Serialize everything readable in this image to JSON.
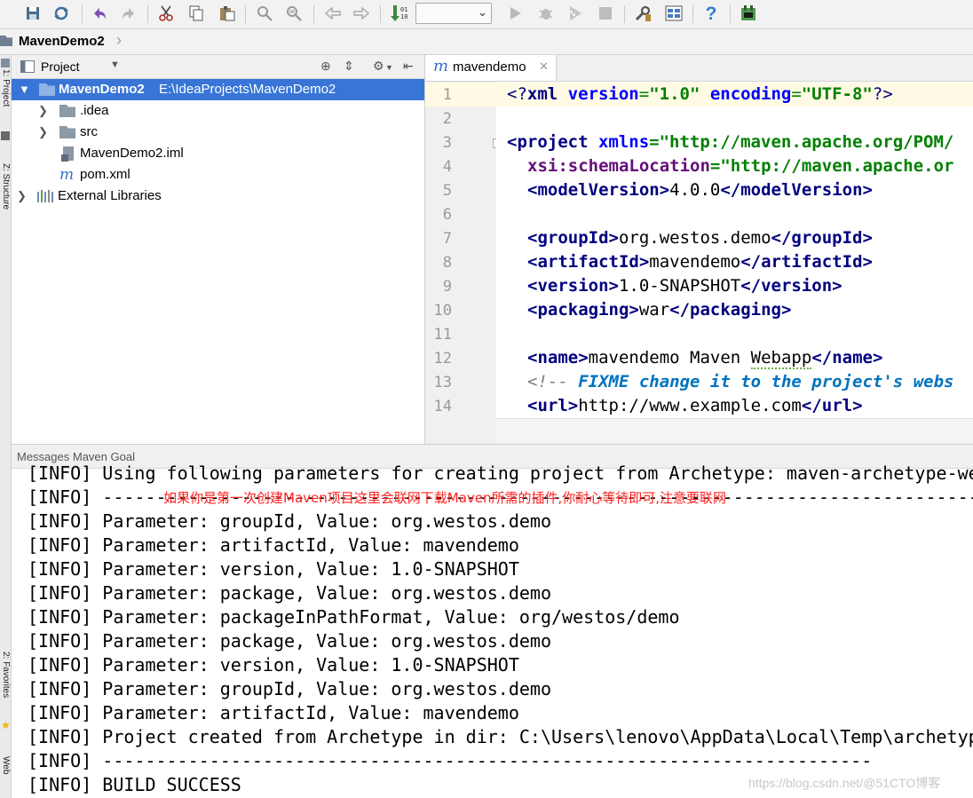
{
  "toolbar": {
    "icons": [
      "save-icon",
      "sync-icon",
      "undo-icon",
      "redo-icon",
      "cut-icon",
      "copy-icon",
      "paste-icon",
      "find-icon",
      "replace-icon",
      "back-icon",
      "forward-icon",
      "make-project-icon",
      "run-config-select",
      "run-icon",
      "debug-icon",
      "coverage-icon",
      "stop-icon",
      "settings-icon",
      "project-structure-icon",
      "help-icon",
      "event-log-icon"
    ],
    "run_config_value": ""
  },
  "navbar": {
    "breadcrumb": "MavenDemo2"
  },
  "left_strip": {
    "tab1": "1: Project",
    "tab2": "Z: Structure",
    "tab3": "2: Favorites",
    "tab4": "Web"
  },
  "project_panel": {
    "title": "Project",
    "tree": [
      {
        "label": "MavenDemo2",
        "path": "E:\\IdeaProjects\\MavenDemo2"
      },
      {
        "label": ".idea"
      },
      {
        "label": "src"
      },
      {
        "label": "MavenDemo2.iml"
      },
      {
        "label": "pom.xml"
      },
      {
        "label": "External Libraries"
      }
    ]
  },
  "editor": {
    "tab_label": "mavendemo",
    "tab_icon_letter": "m",
    "lines": [
      {
        "n": "1"
      },
      {
        "n": "2"
      },
      {
        "n": "3"
      },
      {
        "n": "4"
      },
      {
        "n": "5"
      },
      {
        "n": "6"
      },
      {
        "n": "7"
      },
      {
        "n": "8"
      },
      {
        "n": "9"
      },
      {
        "n": "10"
      },
      {
        "n": "11"
      },
      {
        "n": "12"
      },
      {
        "n": "13"
      },
      {
        "n": "14"
      }
    ],
    "code": {
      "l1_a": "<?",
      "l1_b": "xml",
      "l1_c": " version",
      "l1_d": "=",
      "l1_e": "\"1.0\"",
      "l1_f": " encoding",
      "l1_g": "=",
      "l1_h": "\"UTF-8\"",
      "l1_i": "?>",
      "l3_a": "<project",
      "l3_b": " xmlns",
      "l3_c": "=",
      "l3_d": "\"http://maven.apache.org/POM/",
      "l4_a": "xsi:schemaLocation",
      "l4_b": "=",
      "l4_c": "\"http://maven.apache.or",
      "l5_a": "<modelVersion>",
      "l5_b": "4.0.0",
      "l5_c": "</modelVersion>",
      "l7_a": "<groupId>",
      "l7_b": "org.westos.demo",
      "l7_c": "</groupId>",
      "l8_a": "<artifactId>",
      "l8_b": "mavendemo",
      "l8_c": "</artifactId>",
      "l9_a": "<version>",
      "l9_b": "1.0-SNAPSHOT",
      "l9_c": "</version>",
      "l10_a": "<packaging>",
      "l10_b": "war",
      "l10_c": "</packaging>",
      "l12_a": "<name>",
      "l12_b": "mavendemo Maven ",
      "l12_c": "Webapp",
      "l12_d": "</name>",
      "l13_a": "<!-- ",
      "l13_b": "FIXME change it to the project's webs",
      "l14_a": "<url>",
      "l14_b": "http://www.example.com",
      "l14_c": "</url>"
    }
  },
  "messages": {
    "title": "Messages Maven Goal",
    "log": [
      "[INFO] Using following parameters for creating project from Archetype: maven-archetype-we",
      "[INFO] -----------------------------------------------------------------------------------",
      "[INFO] Parameter: groupId, Value: org.westos.demo",
      "[INFO] Parameter: artifactId, Value: mavendemo",
      "[INFO] Parameter: version, Value: 1.0-SNAPSHOT",
      "[INFO] Parameter: package, Value: org.westos.demo",
      "[INFO] Parameter: packageInPathFormat, Value: org/westos/demo",
      "[INFO] Parameter: package, Value: org.westos.demo",
      "[INFO] Parameter: version, Value: 1.0-SNAPSHOT",
      "[INFO] Parameter: groupId, Value: org.westos.demo",
      "[INFO] Parameter: artifactId, Value: mavendemo",
      "[INFO] Project created from Archetype in dir: C:\\Users\\lenovo\\AppData\\Local\\Temp\\archetyp",
      "[INFO] ------------------------------------------------------------------------",
      "[INFO] BUILD SUCCESS"
    ],
    "annotation": "如果你是第一次创建Maven项目这里会联网下载Maven所需的插件,你耐心等待即可,注意要联网",
    "watermark": "https://blog.csdn.net/@51CTO博客"
  }
}
